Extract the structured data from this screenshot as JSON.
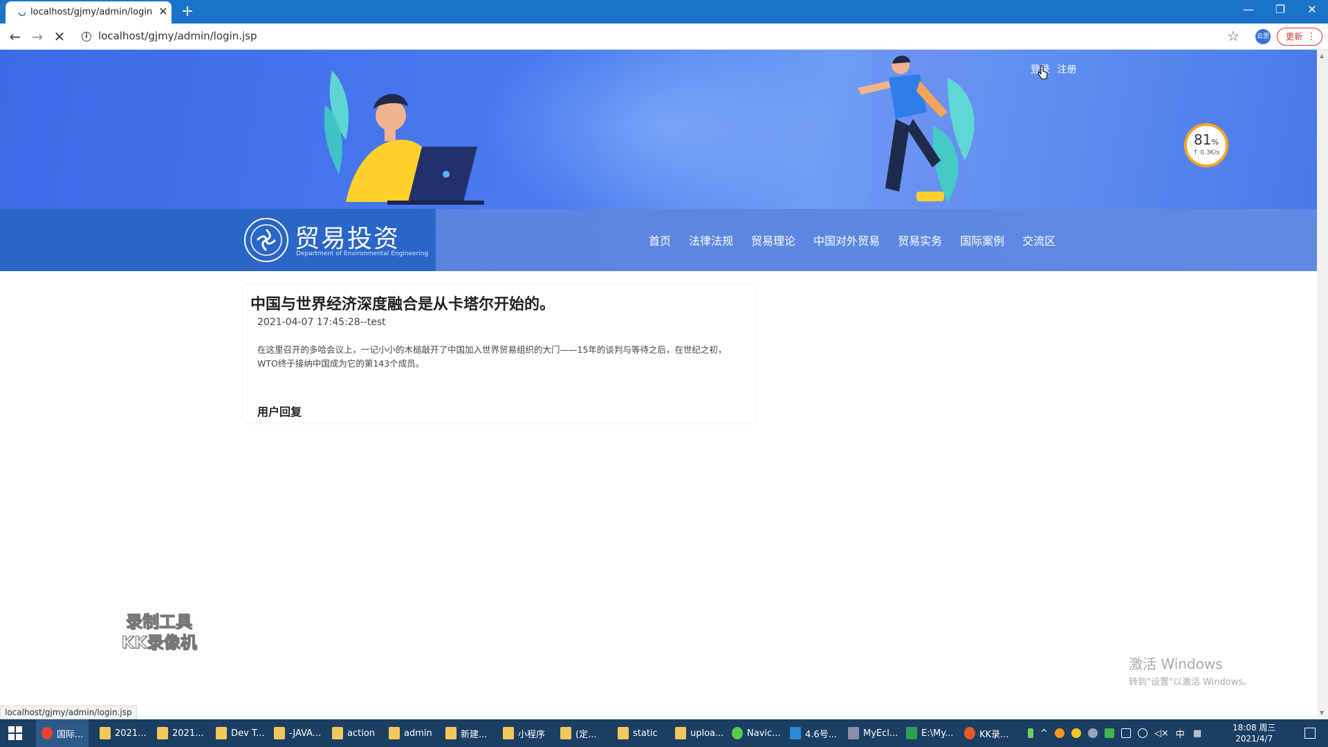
{
  "browser": {
    "tab_title": "localhost/gjmy/admin/login.js",
    "address": "localhost/gjmy/admin/login.jsp",
    "profile_badge": "云思",
    "update_label": "更新",
    "new_tab": "+",
    "close_tab": "✕",
    "window_minimize": "—",
    "window_restore": "❐",
    "window_close": "✕"
  },
  "header": {
    "login": "登录",
    "register": "注册",
    "logo_title": "贸易投资",
    "logo_subtitle": "Department of Environmental Engineering",
    "speed_percent": "81",
    "speed_unit": "%",
    "speed_rate": "↑ 0.3K/s"
  },
  "nav": {
    "items": [
      "首页",
      "法律法规",
      "贸易理论",
      "中国对外贸易",
      "贸易实务",
      "国际案例",
      "交流区"
    ]
  },
  "article": {
    "title": "中国与世界经济深度融合是从卡塔尔开始的。",
    "meta": "2021-04-07 17:45:28--test",
    "body": "在这里召开的多哈会议上，一记小小的木槌敲开了中国加入世界贸易组织的大门——15年的谈判与等待之后，在世纪之初，WTO终于接纳中国成为它的第143个成员。",
    "reply_heading": "用户回复"
  },
  "overlays": {
    "recorder_line1": "录制工具",
    "recorder_line2": "KK录像机",
    "activate_title": "激活 Windows",
    "activate_sub": "转到\"设置\"以激活 Windows。",
    "status_url": "localhost/gjmy/admin/login.jsp"
  },
  "taskbar": {
    "items": [
      "国际...",
      "2021...",
      "2021...",
      "Dev T...",
      "-JAVA...",
      "action",
      "admin",
      "新建...",
      "小程序",
      "(定...",
      "static",
      "uploa...",
      "Navic...",
      "4.6号...",
      "MyEcl...",
      "E:\\My...",
      "KK录..."
    ],
    "tray_ime": "中",
    "clock_time": "18:08 周三",
    "clock_date": "2021/4/7"
  },
  "colors": {
    "tabbar": "#1a73c8",
    "hero": "#4b7cf0",
    "navbar": "#5b86e0",
    "logo_block": "#2a66c8",
    "taskbar": "#1b3e63"
  }
}
